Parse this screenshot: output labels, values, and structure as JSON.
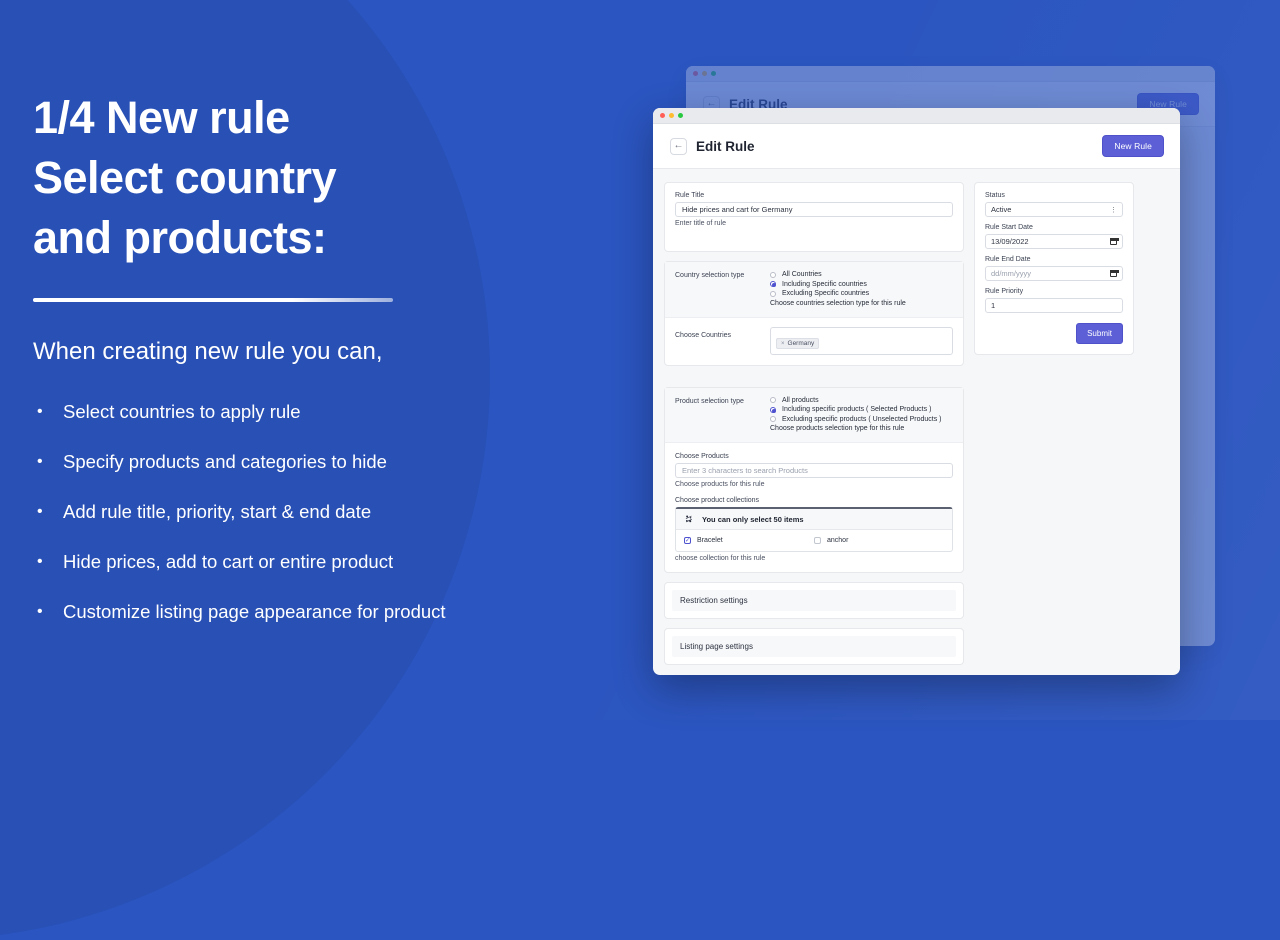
{
  "theme": {
    "background_blue": "#2b55c0",
    "circle_blue": "#2850b5",
    "accent_purple": "#5c5fd6"
  },
  "left_panel": {
    "headline": "1/4 New rule\nSelect country\nand products:",
    "subhead": "When creating new rule you can,",
    "bullet_marker": "•",
    "bullets": [
      "Select countries to apply rule",
      "Specify products and categories to hide",
      "Add rule title, priority, start & end date",
      "Hide prices, add to cart or entire product",
      "Customize listing page appearance for product"
    ]
  },
  "app": {
    "header": {
      "back_icon": "←",
      "title": "Edit Rule",
      "new_rule_label": "New Rule"
    },
    "rule_title": {
      "label": "Rule Title",
      "value": "Hide prices and cart for Germany",
      "help": "Enter title of rule"
    },
    "country_section": {
      "label": "Country selection type",
      "options": [
        {
          "label": "All Countries",
          "selected": false
        },
        {
          "label": "Including Specific countries",
          "selected": true
        },
        {
          "label": "Excluding Specific countries",
          "selected": false
        }
      ],
      "help": "Choose countries selection type for this rule",
      "choose_label": "Choose Countries",
      "chips": [
        {
          "remove_icon": "×",
          "label": "Germany"
        }
      ]
    },
    "product_section": {
      "label": "Product selection type",
      "options": [
        {
          "label": "All products",
          "selected": false
        },
        {
          "label": "Including specific products ( Selected Products )",
          "selected": true
        },
        {
          "label": "Excluding specific products ( Unselected Products )",
          "selected": false
        }
      ],
      "help": "Choose products selection type for this rule",
      "choose_products_label": "Choose Products",
      "choose_products_placeholder": "Enter 3 characters to search Products",
      "choose_products_help": "Choose products for this rule",
      "collections_label": "Choose product collections",
      "collections_banner": "You can only select 50 items",
      "collections": [
        {
          "label": "Bracelet",
          "checked": true
        },
        {
          "label": "anchor",
          "checked": false
        }
      ],
      "collections_help": "choose collection for this rule"
    },
    "side_panel": {
      "status_label": "Status",
      "status_value": "Active",
      "start_date_label": "Rule Start Date",
      "start_date_value": "13/09/2022",
      "end_date_label": "Rule End Date",
      "end_date_placeholder": "dd/mm/yyyy",
      "priority_label": "Rule Priority",
      "priority_value": "1",
      "submit_label": "Submit"
    },
    "accordions": [
      "Restriction settings",
      "Listing page settings"
    ]
  }
}
